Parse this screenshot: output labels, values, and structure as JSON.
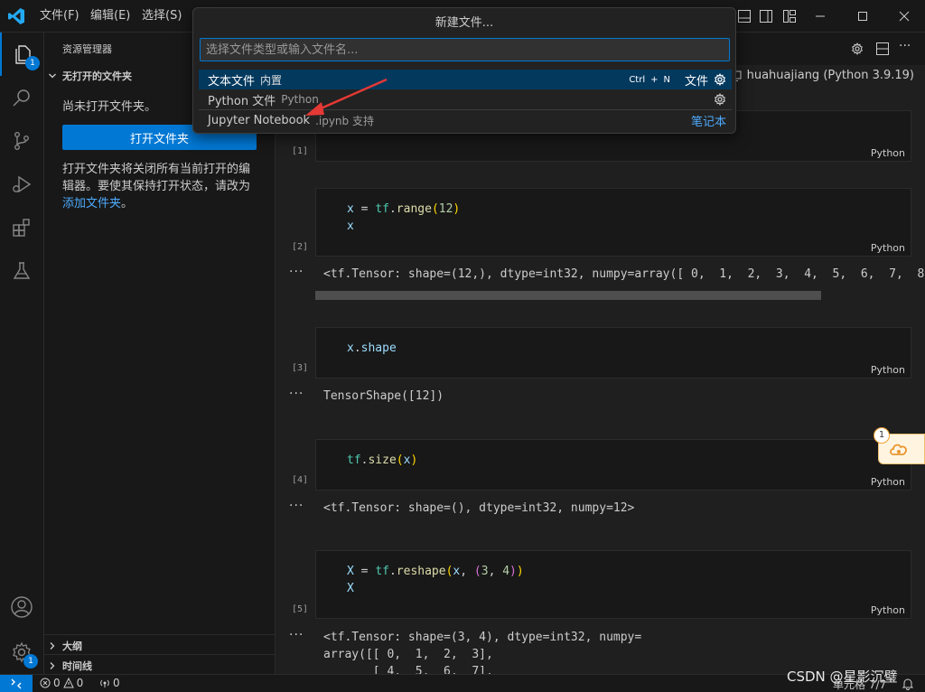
{
  "colors": {
    "accent": "#0078d4",
    "link": "#4daafc",
    "selection": "#04395e",
    "annotation_arrow": "#e53935"
  },
  "titlebar": {
    "menu": [
      "文件(F)",
      "编辑(E)",
      "选择(S)"
    ]
  },
  "activity": {
    "explorer_badge": "1",
    "settings_badge": "1",
    "icons": [
      "files-icon",
      "search-icon",
      "source-control-icon",
      "run-debug-icon",
      "extensions-icon",
      "testing-icon",
      "account-icon",
      "settings-gear-icon"
    ]
  },
  "sidebar": {
    "header": "资源管理器",
    "section_title": "无打开的文件夹",
    "message": "尚未打开文件夹。",
    "open_folder_button": "打开文件夹",
    "paragraph_before": "打开文件夹将关闭所有当前打开的编辑器。要使其保持打开状态，请改为",
    "paragraph_link": "添加文件夹",
    "paragraph_after": "。",
    "outline": "大纲",
    "timeline": "时间线"
  },
  "editor": {
    "kernel": "huahuajiang (Python 3.9.19)",
    "cells": [
      {
        "exec": "[1]",
        "lang": "Python"
      },
      {
        "exec": "[2]",
        "lang": "Python",
        "output": "<tf.Tensor: shape=(12,), dtype=int32, numpy=array([ 0,  1,  2,  3,  4,  5,  6,  7,  8"
      },
      {
        "exec": "[3]",
        "lang": "Python",
        "output": "TensorShape([12])"
      },
      {
        "exec": "[4]",
        "lang": "Python",
        "output": "<tf.Tensor: shape=(), dtype=int32, numpy=12>"
      },
      {
        "exec": "[5]",
        "lang": "Python",
        "output_lines": [
          "<tf.Tensor: shape=(3, 4), dtype=int32, numpy=",
          "array([[ 0,  1,  2,  3],",
          "       [ 4,  5,  6,  7],"
        ]
      }
    ],
    "output_dots": "···"
  },
  "quickpick": {
    "title": "新建文件...",
    "placeholder": "选择文件类型或输入文件名...",
    "items": [
      {
        "label": "文本文件",
        "desc": "内置",
        "key1": "Ctrl",
        "plus": "+",
        "key2": "N",
        "category": "文件"
      },
      {
        "label": "Python 文件",
        "desc": "Python"
      },
      {
        "label": "Jupyter Notebook",
        "desc": ".ipynb 支持",
        "category": "笔记本"
      }
    ]
  },
  "statusbar": {
    "errors": "0",
    "warnings": "0",
    "ports": "0",
    "cell_info": "单元格 7/7"
  },
  "float_widget": {
    "count": "1"
  },
  "watermark": "CSDN @星影沉璧"
}
